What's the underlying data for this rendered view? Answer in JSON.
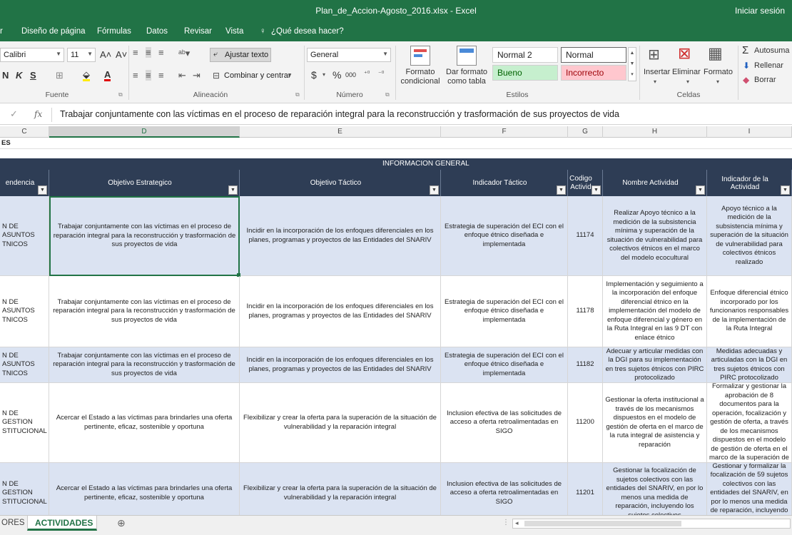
{
  "window": {
    "title": "Plan_de_Accion-Agosto_2016.xlsx - Excel",
    "signin": "Iniciar sesión"
  },
  "tabs": [
    {
      "label": "r"
    },
    {
      "label": "Diseño de página"
    },
    {
      "label": "Fórmulas"
    },
    {
      "label": "Datos"
    },
    {
      "label": "Revisar"
    },
    {
      "label": "Vista"
    },
    {
      "label": "¿Qué desea hacer?"
    }
  ],
  "ribbon": {
    "font_name": "Calibri",
    "font_size": "11",
    "bold": "N",
    "italic": "K",
    "underline": "S",
    "wrap_text": "Ajustar texto",
    "merge_center": "Combinar y centrar",
    "number_format": "General",
    "percent": "%",
    "thousands": "000",
    "conditional_format": "Formato condicional",
    "format_table": "Dar formato como tabla",
    "styles": {
      "normal2": "Normal 2",
      "normal": "Normal",
      "good": "Bueno",
      "bad": "Incorrecto"
    },
    "insert": "Insertar",
    "delete": "Eliminar",
    "format": "Formato",
    "autosum": "Autosuma",
    "fill": "Rellenar",
    "clear": "Borrar",
    "groups": {
      "font": "Fuente",
      "alignment": "Alineación",
      "number": "Número",
      "styles": "Estilos",
      "cells": "Celdas"
    }
  },
  "formula_bar": {
    "content": "Trabajar conjuntamente con las víctimas en el proceso de reparación integral para la reconstrucción y trasformación de sus proyectos de vida"
  },
  "columns": [
    "C",
    "D",
    "E",
    "F",
    "G",
    "H",
    "I"
  ],
  "sheet": {
    "row_label": "ES",
    "section_header": "INFORMACION GENERAL",
    "headers": [
      "endencia",
      "Objetivo Estrategico",
      "Objetivo Táctico",
      "Indicador Táctico",
      "Codigo Activid",
      "Nombre Actividad",
      "Indicador de la Actividad"
    ],
    "rows": [
      {
        "dep": "N DE ASUNTOS TNICOS",
        "obj_est": "Trabajar conjuntamente con las víctimas en el proceso de reparación integral para la reconstrucción y trasformación de sus proyectos de vida",
        "obj_tac": "Incidir en la incorporación de los enfoques diferenciales en los planes, programas y proyectos de las Entidades del SNARIV",
        "ind_tac": "Estrategia de superación del ECI con el enfoque étnico diseñada e implementada",
        "codigo": "11174",
        "nombre": "Realizar Apoyo técnico a la medición de la subsistencia mínima y superación de la situación de vulnerabilidad para colectivos étnicos en el marco del modelo ecocultural",
        "ind_act": "Apoyo técnico a la medición de la subsistencia mínima y superación de la situación de vulnerabilidad para colectivos étnicos realizado"
      },
      {
        "dep": "N DE ASUNTOS TNICOS",
        "obj_est": "Trabajar conjuntamente con las víctimas en el proceso de reparación integral para la reconstrucción y trasformación de sus proyectos de vida",
        "obj_tac": "Incidir en la incorporación de los enfoques diferenciales en los planes, programas y proyectos de las Entidades del SNARIV",
        "ind_tac": "Estrategia de superación del ECI con el enfoque étnico diseñada e implementada",
        "codigo": "11178",
        "nombre": "Implementación y seguimiento a la incorporación del enfoque diferencial étnico en la implementación del modelo de enfoque diferencial y género en la Ruta Integral en las 9 DT con enlace étnico",
        "ind_act": "Enfoque diferencial étnico incorporado por los funcionarios responsables de la implementación de la Ruta Integral"
      },
      {
        "dep": "N DE ASUNTOS TNICOS",
        "obj_est": "Trabajar conjuntamente con las víctimas en el proceso de reparación integral para la reconstrucción y trasformación de sus proyectos de vida",
        "obj_tac": "Incidir en la incorporación de los enfoques diferenciales en los planes, programas y proyectos de las Entidades del SNARIV",
        "ind_tac": "Estrategia de superación del ECI con el enfoque étnico diseñada e implementada",
        "codigo": "11182",
        "nombre": "Adecuar y articular medidas con la DGI para su implementación en tres sujetos étnicos con PIRC protocolizado",
        "ind_act": "Medidas adecuadas y articuladas con la DGI en tres sujetos étnicos con PIRC protocolizado"
      },
      {
        "dep": "N DE GESTION STITUCIONAL",
        "obj_est": "Acercar el Estado a las víctimas para brindarles una oferta pertinente, eficaz, sostenible y oportuna",
        "obj_tac": "Flexibilizar y crear la oferta para la superación de la situación de vulnerabilidad y la reparación integral",
        "ind_tac": "Inclusion efectiva de las solicitudes de acceso a oferta retroalimentadas en SIGO",
        "codigo": "11200",
        "nombre": "Gestionar la oferta institucional a través de los mecanismos dispuestos en el modelo de gestión de oferta en el marco de la ruta integral de asistencia y reparación",
        "ind_act": "Formalizar y gestionar la aprobación de 8 documentos para la operación, focalización y gestión de oferta, a través de los mecanismos dispuestos en el modelo de gestión de oferta en el marco de la superación de"
      },
      {
        "dep": "N DE GESTION STITUCIONAL",
        "obj_est": "Acercar el Estado a las víctimas para brindarles una oferta pertinente, eficaz, sostenible y oportuna",
        "obj_tac": "Flexibilizar y crear la oferta para la superación de la situación de vulnerabilidad y la reparación integral",
        "ind_tac": "Inclusion efectiva de las solicitudes de acceso a oferta retroalimentadas en SIGO",
        "codigo": "11201",
        "nombre": "Gestionar la focalización de sujetos colectivos con las entidades del SNARIV, en por lo menos una medida de reparación, incluyendo los sujetos colectivos",
        "ind_act": "Gestionar y formalizar la focalización de 59 sujetos colectivos con las entidades del SNARIV, en por lo menos una medida de reparación, incluyendo los sujetos"
      }
    ]
  },
  "sheet_tabs": [
    {
      "label": "ORES"
    },
    {
      "label": "ACTIVIDADES"
    }
  ],
  "add_sheet": "⊕"
}
